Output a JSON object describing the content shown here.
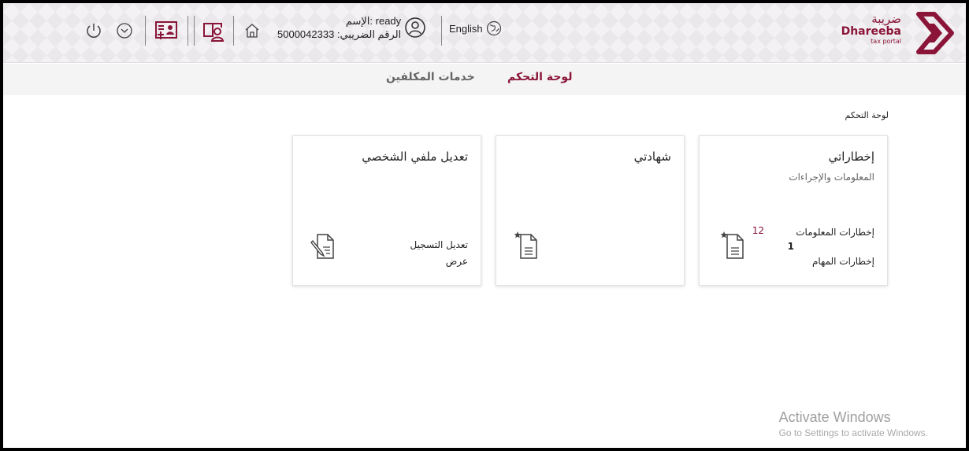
{
  "header": {
    "logo_ar": "ضريبة",
    "logo_en": "Dhareeba",
    "logo_sub": "tax portal",
    "language_label": "English",
    "user_name_line": "الإسم: ready",
    "tax_number_line": "الرقم الضريبي: 5000042333",
    "icons": [
      "power-icon",
      "chevron-down-circle-icon",
      "taxpayer-card-icon",
      "user-profile-icon",
      "home-icon",
      "user-circle-icon",
      "globe-icon"
    ]
  },
  "nav": {
    "dashboard": "لوحة التحكم",
    "taxpayer_services": "خدمات المكلفين"
  },
  "breadcrumb": "لوحة التحكم",
  "cards": {
    "notifications": {
      "title": "إخطاراتي",
      "subtitle": "المعلومات والإجراءات",
      "info_label": "إخطارات المعلومات",
      "info_count": "12",
      "task_count": "1",
      "task_label": "إخطارات المهام"
    },
    "certificates": {
      "title": "شهادتي"
    },
    "profile": {
      "title": "تعديل ملفي الشخصي",
      "edit_registration": "تعديل التسجيل",
      "view": "عرض"
    }
  },
  "watermark": {
    "title": "Activate Windows",
    "subtitle": "Go to Settings to activate Windows."
  },
  "colors": {
    "brand": "#8a1538",
    "nav_bg": "#f4f4f4",
    "header_bg": "#f3f1f3"
  }
}
